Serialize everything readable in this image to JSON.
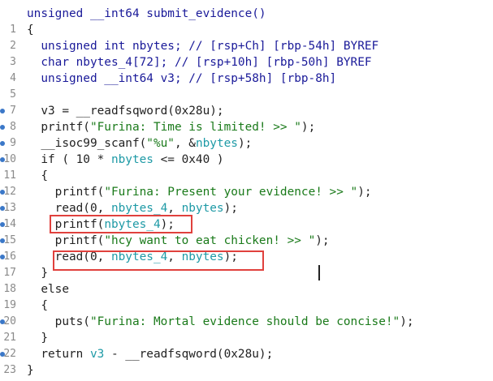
{
  "code_lines": [
    {
      "num": "",
      "tokens": [
        {
          "t": "unsigned __int64 submit_evidence()",
          "c": "c-kw"
        }
      ]
    },
    {
      "num": "1",
      "tokens": [
        {
          "t": "{",
          "c": "c-plain"
        }
      ]
    },
    {
      "num": "2",
      "tokens": [
        {
          "t": "  unsigned int nbytes; // [rsp+Ch] [rbp-54h] BYREF",
          "c": "c-kw"
        }
      ]
    },
    {
      "num": "3",
      "tokens": [
        {
          "t": "  char nbytes_4[72]; // [rsp+10h] [rbp-50h] BYREF",
          "c": "c-kw"
        }
      ]
    },
    {
      "num": "4",
      "tokens": [
        {
          "t": "  unsigned __int64 v3; // [rsp+58h] [rbp-8h]",
          "c": "c-kw"
        }
      ]
    },
    {
      "num": "5",
      "tokens": []
    },
    {
      "num": "7",
      "bp": true,
      "tokens": [
        {
          "t": "  v3 = __readfsqword(0x28u);",
          "c": "c-plain"
        }
      ]
    },
    {
      "num": "8",
      "bp": true,
      "tokens": [
        {
          "t": "  printf(",
          "c": "c-plain"
        },
        {
          "t": "\"Furina: Time is limited! >> \"",
          "c": "c-str"
        },
        {
          "t": ");",
          "c": "c-plain"
        }
      ]
    },
    {
      "num": "9",
      "bp": true,
      "tokens": [
        {
          "t": "  __isoc99_scanf(",
          "c": "c-plain"
        },
        {
          "t": "\"%u\"",
          "c": "c-str"
        },
        {
          "t": ", &",
          "c": "c-plain"
        },
        {
          "t": "nbytes",
          "c": "c-var"
        },
        {
          "t": ");",
          "c": "c-plain"
        }
      ]
    },
    {
      "num": "10",
      "bp": true,
      "tokens": [
        {
          "t": "  if ( 10 * ",
          "c": "c-plain"
        },
        {
          "t": "nbytes",
          "c": "c-var"
        },
        {
          "t": " <= 0x40 )",
          "c": "c-plain"
        }
      ]
    },
    {
      "num": "11",
      "tokens": [
        {
          "t": "  {",
          "c": "c-plain"
        }
      ]
    },
    {
      "num": "12",
      "bp": true,
      "tokens": [
        {
          "t": "    printf(",
          "c": "c-plain"
        },
        {
          "t": "\"Furina: Present your evidence! >> \"",
          "c": "c-str"
        },
        {
          "t": ");",
          "c": "c-plain"
        }
      ]
    },
    {
      "num": "13",
      "bp": true,
      "tokens": [
        {
          "t": "    read(0, ",
          "c": "c-plain"
        },
        {
          "t": "nbytes_4",
          "c": "c-var"
        },
        {
          "t": ", ",
          "c": "c-plain"
        },
        {
          "t": "nbytes",
          "c": "c-var"
        },
        {
          "t": ");",
          "c": "c-plain"
        }
      ]
    },
    {
      "num": "14",
      "bp": true,
      "tokens": [
        {
          "t": "    printf(",
          "c": "c-plain"
        },
        {
          "t": "nbytes_4",
          "c": "c-var"
        },
        {
          "t": ");",
          "c": "c-plain"
        }
      ]
    },
    {
      "num": "15",
      "bp": true,
      "tokens": [
        {
          "t": "    printf(",
          "c": "c-plain"
        },
        {
          "t": "\"hcy want to eat chicken! >> \"",
          "c": "c-str"
        },
        {
          "t": ");",
          "c": "c-plain"
        }
      ]
    },
    {
      "num": "16",
      "bp": true,
      "tokens": [
        {
          "t": "    read(0, ",
          "c": "c-plain"
        },
        {
          "t": "nbytes_4",
          "c": "c-var"
        },
        {
          "t": ", ",
          "c": "c-plain"
        },
        {
          "t": "nbytes",
          "c": "c-var"
        },
        {
          "t": ");",
          "c": "c-plain"
        }
      ]
    },
    {
      "num": "17",
      "tokens": [
        {
          "t": "  }",
          "c": "c-plain"
        }
      ]
    },
    {
      "num": "18",
      "tokens": [
        {
          "t": "  else",
          "c": "c-plain"
        }
      ]
    },
    {
      "num": "19",
      "tokens": [
        {
          "t": "  {",
          "c": "c-plain"
        }
      ]
    },
    {
      "num": "20",
      "bp": true,
      "tokens": [
        {
          "t": "    puts(",
          "c": "c-plain"
        },
        {
          "t": "\"Furina: Mortal evidence should be concise!\"",
          "c": "c-str"
        },
        {
          "t": ");",
          "c": "c-plain"
        }
      ]
    },
    {
      "num": "21",
      "tokens": [
        {
          "t": "  }",
          "c": "c-plain"
        }
      ]
    },
    {
      "num": "22",
      "bp": true,
      "tokens": [
        {
          "t": "  return ",
          "c": "c-plain"
        },
        {
          "t": "v3",
          "c": "c-var"
        },
        {
          "t": " - __readfsqword(0x28u);",
          "c": "c-plain"
        }
      ]
    },
    {
      "num": "23",
      "tokens": [
        {
          "t": "}",
          "c": "c-plain"
        }
      ]
    }
  ],
  "highlight_lines": [
    "14",
    "16"
  ]
}
